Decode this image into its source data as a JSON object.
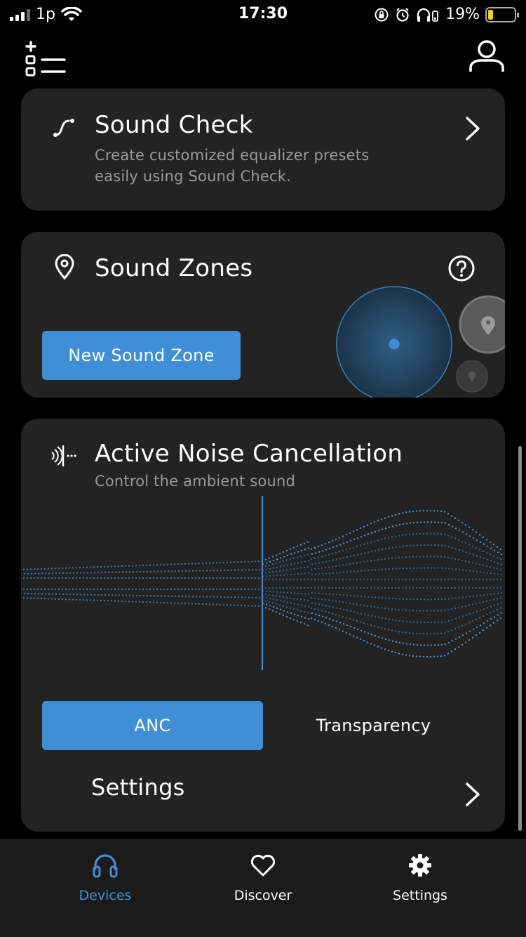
{
  "status_bar": {
    "carrier": "1p",
    "time": "17:30",
    "battery_percent": "19%",
    "battery_level": 0.19
  },
  "sound_check": {
    "title": "Sound Check",
    "subtitle_line1": "Create customized equalizer presets",
    "subtitle_line2": "easily using Sound Check."
  },
  "sound_zones": {
    "title": "Sound Zones",
    "new_zone_button": "New Sound Zone"
  },
  "anc": {
    "title": "Active Noise Cancellation",
    "subtitle": "Control the ambient sound",
    "mode_anc": "ANC",
    "mode_transparency": "Transparency",
    "selected_mode": "ANC",
    "settings_label": "Settings"
  },
  "tabbar": {
    "tabs": [
      {
        "label": "Devices",
        "icon": "headphones-icon",
        "active": true
      },
      {
        "label": "Discover",
        "icon": "heart-icon",
        "active": false
      },
      {
        "label": "Settings",
        "icon": "gear-icon",
        "active": false
      }
    ]
  },
  "colors": {
    "accent": "#3f8fd6",
    "card_bg": "#232323",
    "secondary_text": "#9a9a9a"
  }
}
